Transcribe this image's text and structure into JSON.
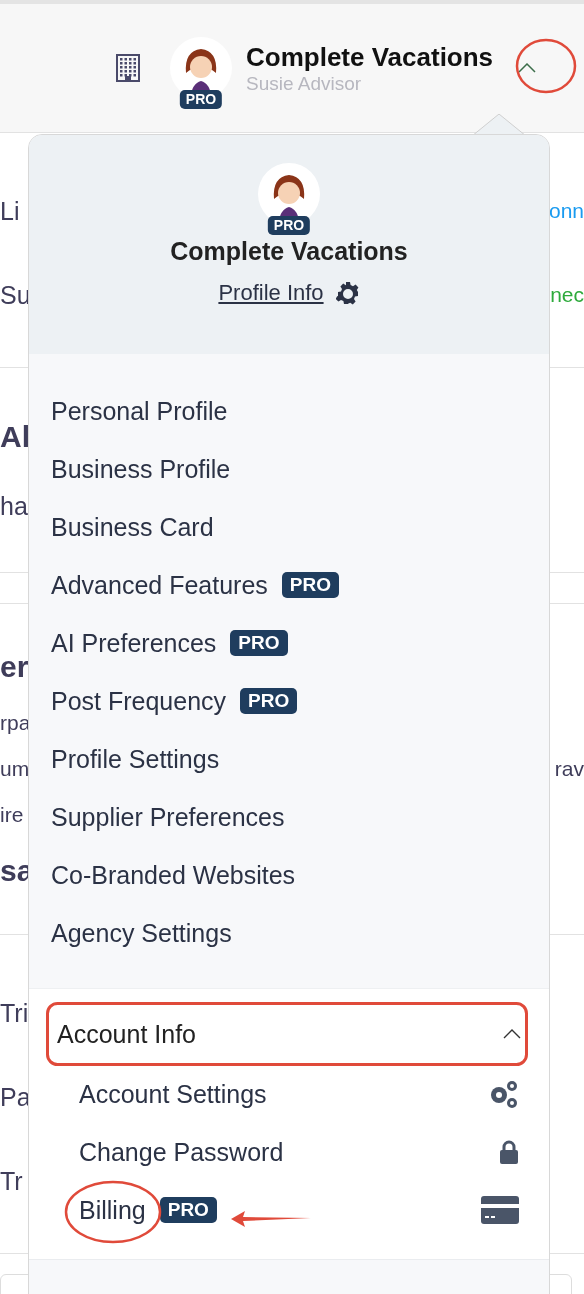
{
  "header": {
    "title": "Complete Vacations",
    "subtitle": "Susie Advisor",
    "badge": "PRO",
    "expanded": true
  },
  "background": {
    "sections": [
      {
        "rows": [
          {
            "kind": "label",
            "left": "Li",
            "right": "onn",
            "color": "#1a9bf0"
          },
          {
            "kind": "label",
            "left": "Su",
            "right": "nec",
            "color": "#2eaa3c"
          }
        ]
      },
      {
        "rows": [
          {
            "kind": "heading",
            "left": "Al"
          },
          {
            "kind": "body",
            "left": "ha"
          }
        ]
      },
      {
        "rows": [
          {
            "kind": "heading",
            "left": "er"
          },
          {
            "kind": "small",
            "left": "rpa"
          },
          {
            "kind": "small",
            "left": "um",
            "right": "rav",
            "color": "#3f3d5a"
          },
          {
            "kind": "small",
            "left": "ire"
          },
          {
            "kind": "heading",
            "left": "sa"
          }
        ]
      },
      {
        "rows": [
          {
            "kind": "label",
            "left": "Tri"
          },
          {
            "kind": "label",
            "left": "Pa"
          },
          {
            "kind": "label",
            "left": "Tr"
          }
        ]
      }
    ]
  },
  "menu": {
    "title": "Complete Vacations",
    "badge": "PRO",
    "link": "Profile Info",
    "items": [
      {
        "label": "Personal Profile"
      },
      {
        "label": "Business Profile"
      },
      {
        "label": "Business Card"
      },
      {
        "label": "Advanced Features",
        "badge": "PRO"
      },
      {
        "label": "AI Preferences",
        "badge": "PRO"
      },
      {
        "label": "Post Frequency",
        "badge": "PRO"
      },
      {
        "label": "Profile Settings"
      },
      {
        "label": "Supplier Preferences"
      },
      {
        "label": "Co-Branded Websites"
      },
      {
        "label": "Agency Settings"
      }
    ],
    "account": {
      "label": "Account Info",
      "expanded": true,
      "items": [
        {
          "label": "Account Settings",
          "kind": "gears"
        },
        {
          "label": "Change Password",
          "kind": "lock"
        },
        {
          "label": "Billing",
          "kind": "card",
          "badge": "PRO"
        }
      ]
    }
  }
}
